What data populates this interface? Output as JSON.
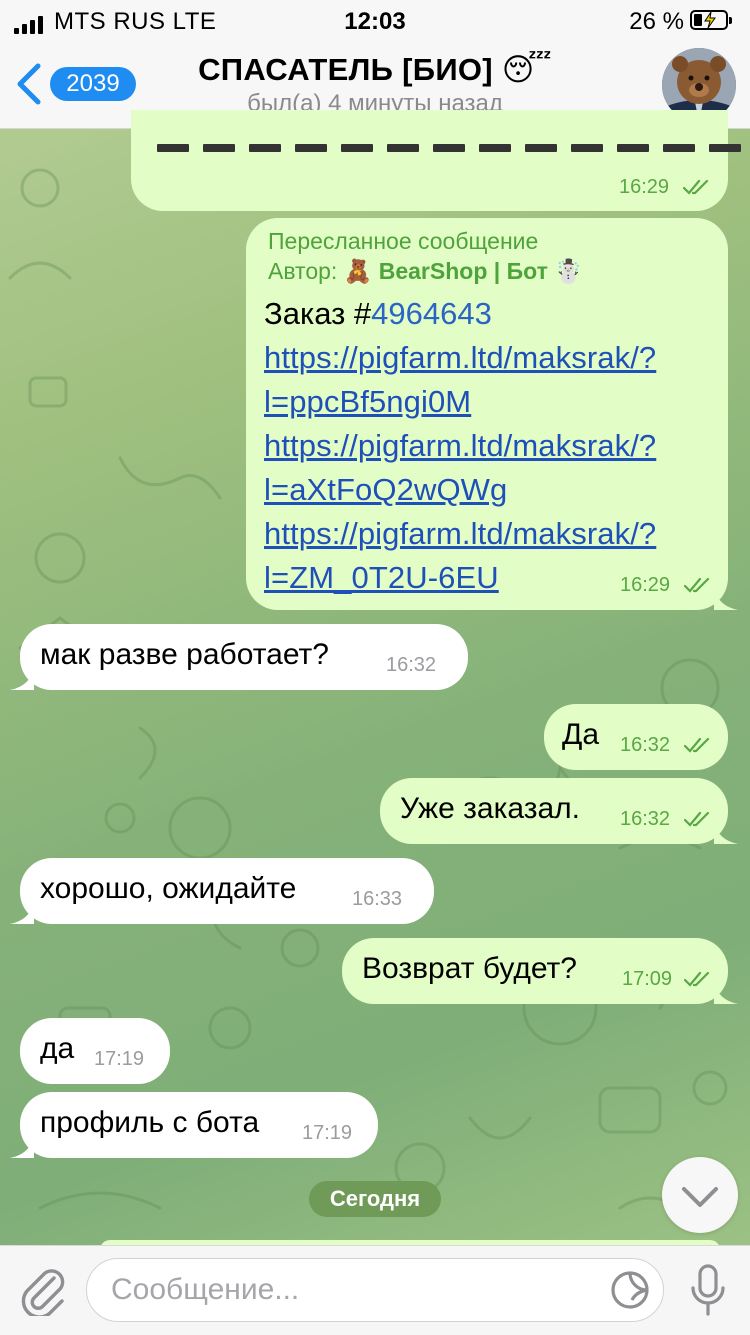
{
  "status_bar": {
    "carrier": "MTS RUS   LTE",
    "time": "12:03",
    "battery": "26 %"
  },
  "header": {
    "back_count": "2039",
    "title": "СПАСАТЕЛЬ [БИО] 😴",
    "subtitle": "был(а) 4 минуты назад"
  },
  "messages": [
    {
      "direction": "out",
      "time": "16:29"
    },
    {
      "direction": "out",
      "forwarded_label": "Пересланное сообщение",
      "author_prefix": "Автор: 🧸 ",
      "author_name": "BearShop | Бот ☃️",
      "order_prefix": "Заказ #",
      "order_number": "4964643",
      "links": [
        [
          "https://pigfarm.ltd/maksrak/?",
          "l=ppcBf5ngi0M"
        ],
        [
          "https://pigfarm.ltd/maksrak/?",
          "l=aXtFoQ2wQWg"
        ],
        [
          "https://pigfarm.ltd/maksrak/?",
          "l=ZM_0T2U-6EU"
        ]
      ],
      "time": "16:29"
    },
    {
      "direction": "in",
      "text": "мак разве работает?",
      "time": "16:32"
    },
    {
      "direction": "out",
      "text": "Да",
      "time": "16:32"
    },
    {
      "direction": "out",
      "text": "Уже заказал.",
      "time": "16:32"
    },
    {
      "direction": "in",
      "text": "хорошо, ожидайте",
      "time": "16:33"
    },
    {
      "direction": "out",
      "text": "Возврат будет?",
      "time": "17:09"
    },
    {
      "direction": "in",
      "text": "да",
      "time": "17:19"
    },
    {
      "direction": "in",
      "text": "профиль с бота",
      "time": "17:19"
    }
  ],
  "date_separator": "Сегодня",
  "composer": {
    "placeholder": "Сообщение..."
  },
  "colors": {
    "outgoing_bubble": "#e2fdc6",
    "incoming_bubble": "#ffffff",
    "accent_green": "#4ea43a",
    "link_blue": "#1f4fb8",
    "badge_blue": "#1e8cf0"
  },
  "icons": [
    "back-chevron-icon",
    "read-ticks-icon",
    "scroll-down-icon",
    "attach-icon",
    "sticker-icon",
    "mic-icon"
  ]
}
